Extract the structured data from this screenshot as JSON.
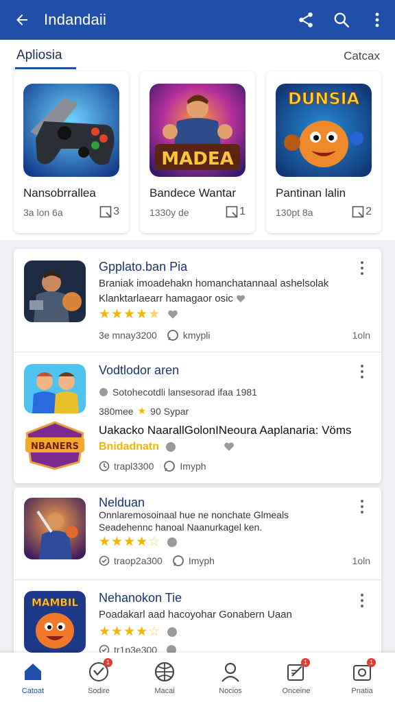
{
  "appbar": {
    "title": "Indandaii",
    "accent": "#1f4fa8"
  },
  "tabs": {
    "left": "Apliosia",
    "right": "Catcax"
  },
  "featured": [
    {
      "name": "Nansobrrallea",
      "meta": "3a lon 6a",
      "count": "3",
      "icon": "gamepad-icon"
    },
    {
      "name": "Bandece Wantar",
      "meta": "1330y de",
      "count": "1",
      "icon": "hero-game-icon",
      "art_text": "MADEA"
    },
    {
      "name": "Pantinan lalin",
      "meta": "130pt 8a",
      "count": "2",
      "icon": "monster-game-icon",
      "art_text": "DUNSIA"
    }
  ],
  "list": [
    {
      "title": "Gpplato.ban Pia",
      "line1": "Braniak imoadehakn homanchatannaal ashelsolak",
      "line2": "Klanktarlaearr hamagaor osic",
      "rating": 4.5,
      "meta": "3e mnay3200",
      "meta2": "kmypli",
      "right": "1oln"
    },
    {
      "title": "Vodtlodor aren",
      "line1": "Sotohecotdli lansesorad ifaa 1981",
      "line2": "380mee",
      "line2b": "90 Sypar",
      "line3": "Uakacko NaarallGolonINeoura Aaplanaria: Vöms",
      "line4": "Bnidadnatn",
      "meta": "trapl3300",
      "meta2": "Imyph",
      "badge_text": "NBANERS"
    },
    {
      "title": "Nelduan",
      "line1": "Onnlaremosoinaal hue ne nonchate Glmeals",
      "line2": "Seadehennc hanoal Naanurkagel ken.",
      "rating": 4,
      "meta": "traop2a300",
      "meta2": "Imyph",
      "right": "1oln"
    },
    {
      "title": "Nehanokon Tie",
      "line1": "Poadakarl aad hacoyohar Gonabern Uaan",
      "rating": 4,
      "meta": "tr1p3e300",
      "badge_text": "MAMBIL"
    }
  ],
  "bottomnav": [
    {
      "label": "Catoat",
      "icon": "home-icon",
      "active": true
    },
    {
      "label": "Sodire",
      "icon": "heart-icon",
      "badge": "1"
    },
    {
      "label": "Macai",
      "icon": "globe-icon"
    },
    {
      "label": "Nocios",
      "icon": "profile-icon"
    },
    {
      "label": "Onceine",
      "icon": "edit-icon",
      "badge": "1"
    },
    {
      "label": "Pnatia",
      "icon": "camera-icon",
      "badge": "1"
    }
  ]
}
